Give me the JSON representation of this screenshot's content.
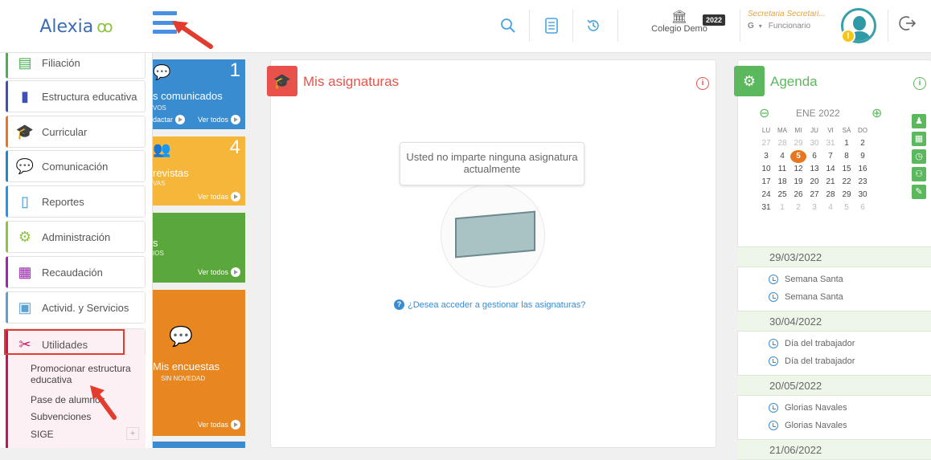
{
  "header": {
    "logo_text": "Alexia",
    "school_name": "Colegio Demo",
    "year_badge": "2022",
    "user_title": "Secretaria Secretari...",
    "user_role": "Funcionario",
    "user_initial": "G",
    "alert_glyph": "!",
    "icons": [
      "search-icon",
      "document-icon",
      "history-icon",
      "logout-icon"
    ]
  },
  "sidebar": {
    "items": [
      {
        "label": "Filiación",
        "icon": "id-card-icon",
        "color": "#4caf50"
      },
      {
        "label": "Estructura educativa",
        "icon": "book-icon",
        "color": "#3f51b5"
      },
      {
        "label": "Curricular",
        "icon": "graduation-cap-icon",
        "color": "#e8761f"
      },
      {
        "label": "Comunicación",
        "icon": "chat-bubbles-icon",
        "color": "#1e88c8"
      },
      {
        "label": "Reportes",
        "icon": "report-icon",
        "color": "#2196f3"
      },
      {
        "label": "Administración",
        "icon": "gears-icon",
        "color": "#8cc63f"
      },
      {
        "label": "Recaudación",
        "icon": "cash-register-icon",
        "color": "#9c27b0"
      },
      {
        "label": "Activid. y Servicios",
        "icon": "calendar-clock-icon",
        "color": "#5aa1d6"
      },
      {
        "label": "Utilidades",
        "icon": "tools-icon",
        "color": "#c2185b"
      }
    ],
    "sub_items": [
      {
        "label": "Promocionar estructura educativa"
      },
      {
        "label": "Pase de alumnos"
      },
      {
        "label": "Subvenciones"
      },
      {
        "label": "SIGE"
      }
    ],
    "expand_glyph": "+"
  },
  "tiles": [
    {
      "title": "s comunicados",
      "subtitle": "VOS",
      "count": "1",
      "link_a": "dactar",
      "link_b": "Ver todos",
      "color": "#3a8cd1"
    },
    {
      "title": "revistas",
      "subtitle": "VAS",
      "count": "4",
      "link_b": "Ver todas",
      "color": "#f5b63a"
    },
    {
      "title": "s",
      "subtitle": "IOS",
      "count": "",
      "link_b": "Ver todos",
      "color": "#5aa83c"
    },
    {
      "title": "Mis encuestas",
      "subtitle": "SIN NOVEDAD",
      "count": "",
      "link_b": "Ver todas",
      "color": "#e8861f"
    }
  ],
  "asignaturas": {
    "title": "Mis asignaturas",
    "empty_message": "Usted no imparte ninguna asignatura actualmente",
    "question_link": "¿Desea acceder a gestionar las asignaturas?",
    "info_glyph": "i",
    "question_glyph": "?",
    "accent": "#e8524a"
  },
  "agenda": {
    "title": "Agenda",
    "info_glyph": "i",
    "accent": "#5cb85c",
    "calendar": {
      "month_label": "ENE 2022",
      "weekdays": [
        "LU",
        "MA",
        "MI",
        "JU",
        "VI",
        "SÁ",
        "DO"
      ],
      "weeks": [
        [
          "27",
          "28",
          "29",
          "30",
          "31",
          "1",
          "2"
        ],
        [
          "3",
          "4",
          "5",
          "6",
          "7",
          "8",
          "9"
        ],
        [
          "10",
          "11",
          "12",
          "13",
          "14",
          "15",
          "16"
        ],
        [
          "17",
          "18",
          "19",
          "20",
          "21",
          "22",
          "23"
        ],
        [
          "24",
          "25",
          "26",
          "27",
          "28",
          "29",
          "30"
        ],
        [
          "31",
          "1",
          "2",
          "3",
          "4",
          "5",
          "6"
        ]
      ],
      "today": "5"
    },
    "side_buttons": [
      "user-icon",
      "calendar-icon",
      "clock-icon",
      "group-icon",
      "pencil-icon"
    ],
    "groups": [
      {
        "date": "29/03/2022",
        "events": [
          "Semana Santa",
          "Semana Santa"
        ]
      },
      {
        "date": "30/04/2022",
        "events": [
          "Día del trabajador",
          "Día del trabajador"
        ]
      },
      {
        "date": "20/05/2022",
        "events": [
          "Glorias Navales",
          "Glorias Navales"
        ]
      },
      {
        "date": "21/06/2022",
        "events": []
      }
    ]
  }
}
